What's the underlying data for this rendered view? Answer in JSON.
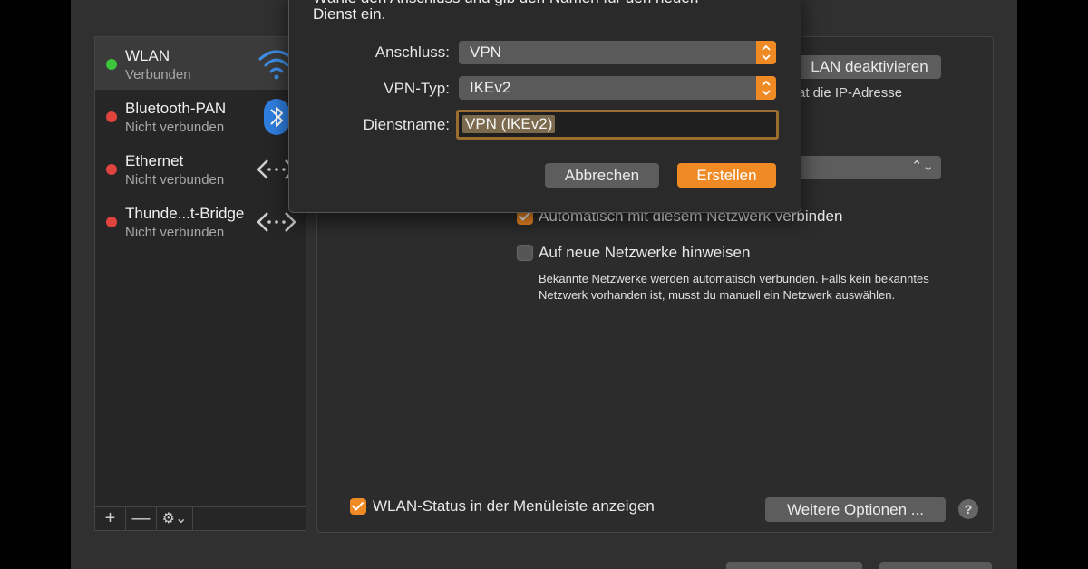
{
  "sidebar": {
    "items": [
      {
        "name": "WLAN",
        "status": "Verbunden",
        "status_color": "#3cc43c",
        "icon": "wifi-icon"
      },
      {
        "name": "Bluetooth-PAN",
        "status": "Nicht verbunden",
        "status_color": "#e0443e",
        "icon": "bluetooth-icon"
      },
      {
        "name": "Ethernet",
        "status": "Nicht verbunden",
        "status_color": "#e0443e",
        "icon": "ethernet-arrows-icon"
      },
      {
        "name": "Thunde...t-Bridge",
        "status": "Nicht verbunden",
        "status_color": "#e0443e",
        "icon": "ethernet-arrows-icon"
      }
    ],
    "tools": {
      "add": "+",
      "remove": "—",
      "gear": "⚙︎⌄"
    }
  },
  "panel": {
    "wlan_toggle_button": "LAN deaktivieren",
    "ip_text": "at die IP-Adresse",
    "auto_join_label": "Automatisch mit diesem Netzwerk verbinden",
    "ask_new_label": "Auf neue Netzwerke hinweisen",
    "hint": "Bekannte Netzwerke werden automatisch verbunden. Falls kein bekanntes Netzwerk vorhanden ist, musst du manuell ein Netzwerk auswählen.",
    "show_status_label": "WLAN-Status in der Menüleiste anzeigen",
    "more_options_button": "Weitere Optionen ...",
    "help": "?"
  },
  "dialog": {
    "intro_line1": "Wähle den Anschluss und gib den Namen für den neuen",
    "intro_line2": "Dienst ein.",
    "interface_label": "Anschluss:",
    "interface_value": "VPN",
    "vpn_type_label": "VPN-Typ:",
    "vpn_type_value": "IKEv2",
    "service_name_label": "Dienstname:",
    "service_name_value": "VPN (IKEv2)",
    "cancel_button": "Abbrechen",
    "create_button": "Erstellen"
  },
  "colors": {
    "accent": "#f08a24",
    "connected": "#3cc43c",
    "disconnected": "#e0443e"
  }
}
